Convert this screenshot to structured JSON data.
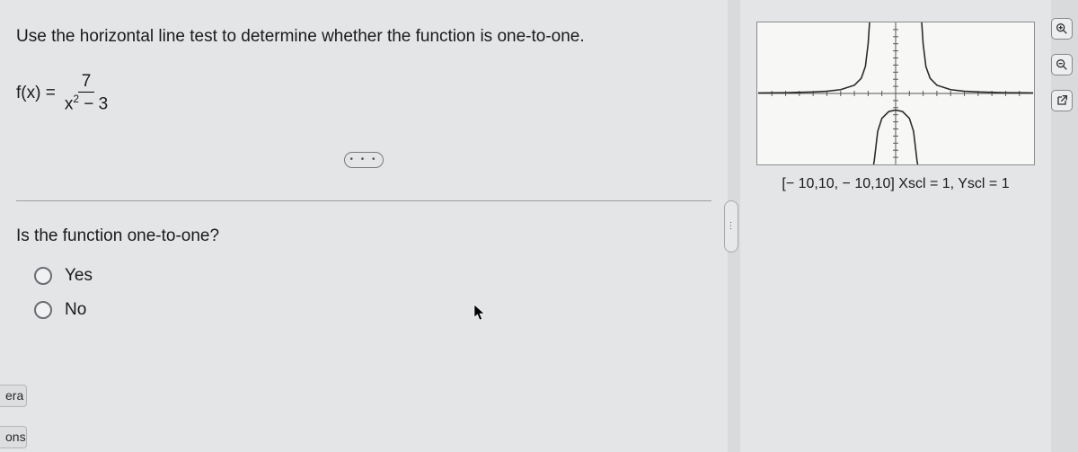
{
  "instruction": "Use the horizontal line test to determine whether the function is one-to-one.",
  "equation": {
    "left": "f(x) =",
    "numerator": "7",
    "denominator_pre": "x",
    "denominator_sup": "2",
    "denominator_post": " − 3"
  },
  "dots": "• • •",
  "question": "Is the function one-to-one?",
  "options": {
    "yes": "Yes",
    "no": "No"
  },
  "side_tabs": {
    "tab1": "era",
    "tab2": "ons"
  },
  "expander_dots": "⋮",
  "graph_caption": "[− 10,10, − 10,10] Xscl = 1, Yscl = 1",
  "chart_data": {
    "type": "line",
    "title": "",
    "xlabel": "",
    "ylabel": "",
    "xlim": [
      -10,
      10
    ],
    "ylim": [
      -10,
      10
    ],
    "xscl": 1,
    "yscl": 1,
    "function": "7/(x^2 - 3)",
    "asymptotes_x": [
      -1.732,
      1.732
    ],
    "series": [
      {
        "name": "f(x)=7/(x^2-3)",
        "x": [
          -10,
          -8,
          -6,
          -5,
          -4,
          -3,
          -2.5,
          -2.2,
          -2.0,
          -1.9,
          -1.85,
          -1.8,
          -1.65,
          -1.6,
          -1.5,
          -1.3,
          -1.0,
          -0.5,
          0,
          0.5,
          1.0,
          1.3,
          1.5,
          1.6,
          1.65,
          1.8,
          1.85,
          1.9,
          2.0,
          2.2,
          2.5,
          3,
          4,
          5,
          6,
          8,
          10
        ],
        "values": [
          0.07,
          0.11,
          0.21,
          0.32,
          0.54,
          1.17,
          2.15,
          3.8,
          7.0,
          11.48,
          16.37,
          28.93,
          -25.93,
          -16.28,
          -9.33,
          -5.34,
          -3.5,
          -2.55,
          -2.33,
          -2.55,
          -3.5,
          -5.34,
          -9.33,
          -16.28,
          -25.93,
          28.93,
          16.37,
          11.48,
          7.0,
          3.8,
          2.15,
          1.17,
          0.54,
          0.32,
          0.21,
          0.11,
          0.07
        ]
      }
    ]
  }
}
